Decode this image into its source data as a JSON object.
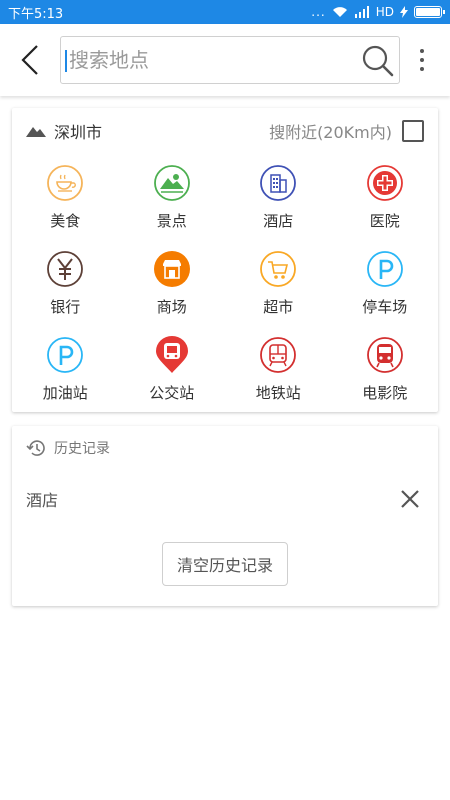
{
  "status_bar": {
    "time": "下午5:13",
    "signal_text": "...",
    "network": "HD",
    "bg_color": "#1E88E5"
  },
  "header": {
    "search": {
      "placeholder": "搜索地点",
      "value": "",
      "icon": "search-icon"
    },
    "back_icon": "back-arrow-icon",
    "more_icon": "more-vertical-icon"
  },
  "category_card": {
    "city": "深圳市",
    "city_icon": "mountain-icon",
    "nearby_label": "搜附近(20Km内)",
    "nearby_checked": false,
    "items": [
      {
        "label": "美食",
        "icon": "food-icon",
        "color": "#F5B45A"
      },
      {
        "label": "景点",
        "icon": "scenery-icon",
        "color": "#4CAF50"
      },
      {
        "label": "酒店",
        "icon": "hotel-icon",
        "color": "#3F51B5"
      },
      {
        "label": "医院",
        "icon": "hospital-icon",
        "color": "#E53935"
      },
      {
        "label": "银行",
        "icon": "bank-icon",
        "color": "#5D4037"
      },
      {
        "label": "商场",
        "icon": "mall-icon",
        "color": "#F57C00"
      },
      {
        "label": "超市",
        "icon": "supermarket-icon",
        "color": "#F9A825"
      },
      {
        "label": "停车场",
        "icon": "parking-icon",
        "color": "#29B6F6"
      },
      {
        "label": "加油站",
        "icon": "gas-station-icon",
        "color": "#29B6F6"
      },
      {
        "label": "公交站",
        "icon": "bus-station-icon",
        "color": "#E53935"
      },
      {
        "label": "地铁站",
        "icon": "subway-icon",
        "color": "#D32F2F"
      },
      {
        "label": "电影院",
        "icon": "cinema-icon",
        "color": "#D32F2F"
      }
    ]
  },
  "history_card": {
    "title": "历史记录",
    "title_icon": "history-icon",
    "items": [
      {
        "text": "酒店",
        "delete_icon": "close-icon"
      }
    ],
    "clear_label": "清空历史记录"
  }
}
